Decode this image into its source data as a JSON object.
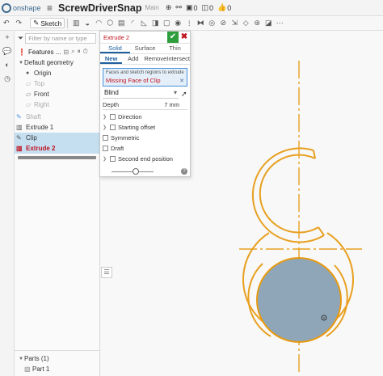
{
  "app": {
    "brand": "onshape",
    "document_title": "ScrewDriverSnap",
    "branch": "Main"
  },
  "top_counters": {
    "parts_count": "0",
    "versions_count": "0",
    "likes_count": "0"
  },
  "toolbar": {
    "sketch_label": "Sketch"
  },
  "features_panel": {
    "filter_placeholder": "Filter by name or type",
    "header_label": "Features ...",
    "items": [
      {
        "label": "Default geometry",
        "state": "normal"
      },
      {
        "label": "Origin",
        "state": "normal"
      },
      {
        "label": "Top",
        "state": "dim"
      },
      {
        "label": "Front",
        "state": "normal"
      },
      {
        "label": "Right",
        "state": "dim"
      },
      {
        "label": "Shaft",
        "state": "dim"
      },
      {
        "label": "Extrude 1",
        "state": "normal"
      },
      {
        "label": "Clip",
        "state": "selected"
      },
      {
        "label": "Extrude 2",
        "state": "error"
      }
    ],
    "parts_label": "Parts (1)",
    "part_item": "Part 1"
  },
  "extrude_dialog": {
    "title": "Extrude 2",
    "type_tabs": [
      "Solid",
      "Surface",
      "Thin"
    ],
    "active_type": "Solid",
    "op_tabs": [
      "New",
      "Add",
      "Remove",
      "Intersect"
    ],
    "active_op": "New",
    "region_label": "Faces and sketch regions to extrude",
    "region_value": "Missing Face of Clip",
    "end_type": "Blind",
    "depth_label": "Depth",
    "depth_value": "7 mm",
    "options": [
      {
        "label": "Direction",
        "expandable": true,
        "checkbox": true
      },
      {
        "label": "Starting offset",
        "expandable": true,
        "checkbox": true
      },
      {
        "label": "Symmetric",
        "expandable": false,
        "checkbox": true
      },
      {
        "label": "Draft",
        "expandable": false,
        "checkbox": true
      },
      {
        "label": "Second end position",
        "expandable": true,
        "checkbox": true
      }
    ]
  },
  "colors": {
    "sketch_orange": "#e8a020",
    "face_fill": "#8fa6b8",
    "face_outline": "#e89a10",
    "error_red": "#c1121f",
    "accent_blue": "#1f5f9e",
    "ok_green": "#2e9e3c"
  }
}
